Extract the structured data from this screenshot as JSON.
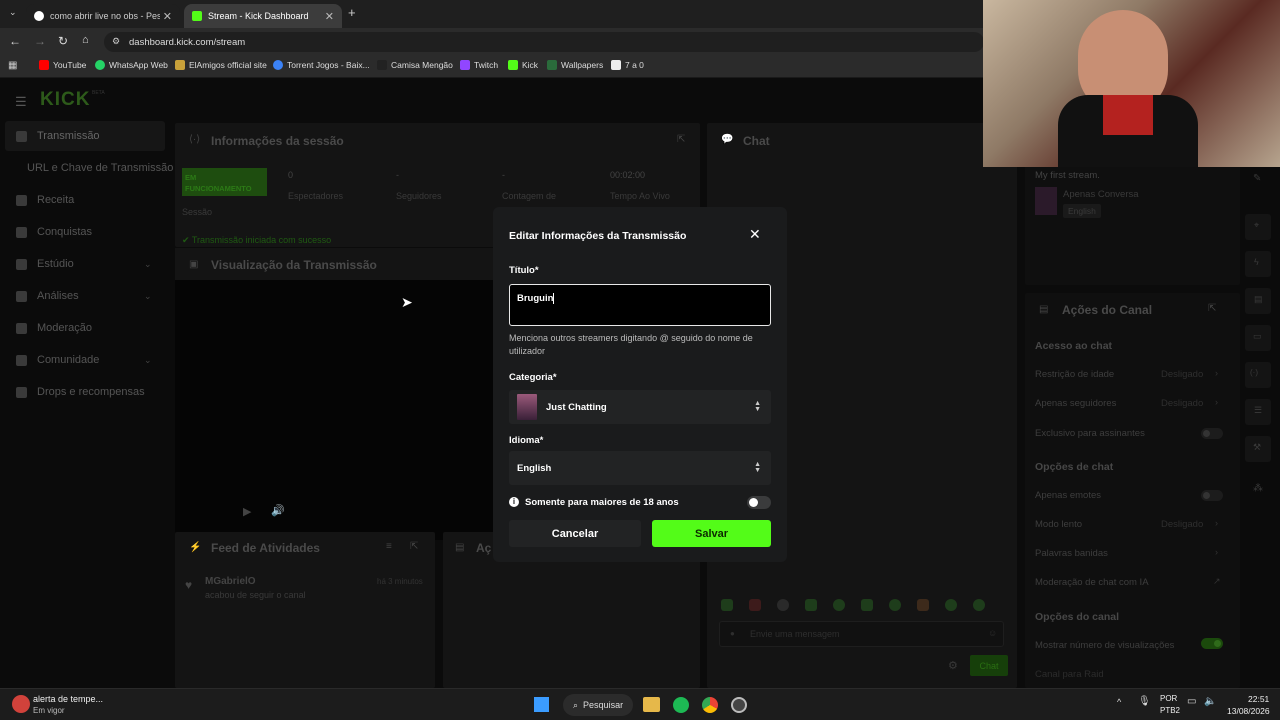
{
  "browser": {
    "tabs": [
      {
        "title": "como abrir live no obs - Pesqui",
        "active": false
      },
      {
        "title": "Stream - Kick Dashboard",
        "active": true
      }
    ],
    "url": "dashboard.kick.com/stream",
    "bookmarks": [
      "YouTube",
      "WhatsApp Web",
      "ElAmigos official site",
      "Torrent Jogos - Baix...",
      "Camisa Mengão",
      "Twitch",
      "Kick",
      "Wallpapers",
      "7 a 0"
    ]
  },
  "sidebar": {
    "logo": "KICK",
    "logo_badge": "BETA",
    "items": [
      {
        "label": "Transmissão",
        "expand": false
      },
      {
        "label": "URL e Chave de Transmissão",
        "expand": false
      },
      {
        "label": "Receita",
        "expand": false
      },
      {
        "label": "Conquistas",
        "expand": false
      },
      {
        "label": "Estúdio",
        "expand": true
      },
      {
        "label": "Análises",
        "expand": true
      },
      {
        "label": "Moderação",
        "expand": false
      },
      {
        "label": "Comunidade",
        "expand": true
      },
      {
        "label": "Drops e recompensas",
        "expand": false
      }
    ]
  },
  "session": {
    "title": "Informações da sessão",
    "status": "EM FUNCIONAMENTO",
    "status_label": "Sessão",
    "stats": [
      {
        "value": "0",
        "label": "Espectadores"
      },
      {
        "value": "-",
        "label": "Seguidores"
      },
      {
        "value": "-",
        "label": "Contagem de"
      },
      {
        "value": "00:02:00",
        "label": "Tempo Ao Vivo"
      }
    ],
    "success": "Transmissão iniciada com sucesso"
  },
  "preview": {
    "title": "Visualização da Transmissão"
  },
  "feed": {
    "title": "Feed de Atividades",
    "items": [
      {
        "user": "MGabrielO",
        "action": "acabou de seguir o canal",
        "time": "há 3 minutos"
      }
    ]
  },
  "actions_panel": {
    "title": "Aç"
  },
  "chat": {
    "title": "Chat",
    "placeholder": "Envie uma mensagem",
    "send": "Chat"
  },
  "stream_info": {
    "title": "My first stream.",
    "category": "Apenas Conversa",
    "language": "English"
  },
  "channel_actions": {
    "title": "Ações do Canal",
    "sections": [
      {
        "heading": "Acesso ao chat",
        "items": [
          {
            "label": "Restrição de idade",
            "value": "Desligado"
          },
          {
            "label": "Apenas seguidores",
            "value": "Desligado"
          },
          {
            "label": "Exclusivo para assinantes",
            "value": ""
          }
        ]
      },
      {
        "heading": "Opções de chat",
        "items": [
          {
            "label": "Apenas emotes",
            "value": ""
          },
          {
            "label": "Modo lento",
            "value": "Desligado"
          },
          {
            "label": "Palavras banidas",
            "value": ""
          },
          {
            "label": "Moderação de chat com IA",
            "value": ""
          }
        ]
      },
      {
        "heading": "Opções do canal",
        "items": [
          {
            "label": "Mostrar número de visualizações",
            "value": ""
          },
          {
            "label": "Canal para Raid",
            "value": ""
          }
        ]
      }
    ]
  },
  "modal": {
    "title": "Editar Informações da Transmissão",
    "title_label": "Título*",
    "title_value": "Bruguin",
    "helper": "Menciona outros streamers digitando @ seguido do nome de utilizador",
    "category_label": "Categoria*",
    "category_value": "Just Chatting",
    "language_label": "Idioma*",
    "language_value": "English",
    "mature_label": "Somente para maiores de 18 anos",
    "cancel": "Cancelar",
    "save": "Salvar"
  },
  "taskbar": {
    "weather_title": "alerta de tempe...",
    "weather_sub": "Em vigor",
    "search": "Pesquisar",
    "lang": "POR",
    "lang2": "PTB2",
    "time": "22:51",
    "date": "13/08/2026"
  },
  "colors": {
    "accent": "#53fc18",
    "modal_bg": "#1a1b1c"
  }
}
